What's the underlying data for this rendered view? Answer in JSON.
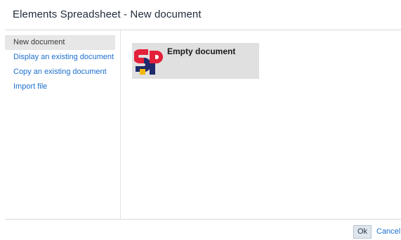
{
  "dialog": {
    "title": "Elements Spreadsheet - New document"
  },
  "sidebar": {
    "items": [
      {
        "label": "New document",
        "selected": true
      },
      {
        "label": "Display an existing document",
        "selected": false
      },
      {
        "label": "Copy an existing document",
        "selected": false
      },
      {
        "label": "Import file",
        "selected": false
      }
    ]
  },
  "content": {
    "tiles": [
      {
        "label": "Empty document",
        "icon": "spreadsheet-logo-icon"
      }
    ]
  },
  "footer": {
    "ok_label": "Ok",
    "cancel_label": "Cancel"
  },
  "colors": {
    "link": "#1c6fcf",
    "selected_bg": "#e7e7e7",
    "tile_bg": "#e0e0e0",
    "logo_red": "#e4203a",
    "logo_navy": "#1e2a6b",
    "logo_yellow": "#f2b705"
  }
}
